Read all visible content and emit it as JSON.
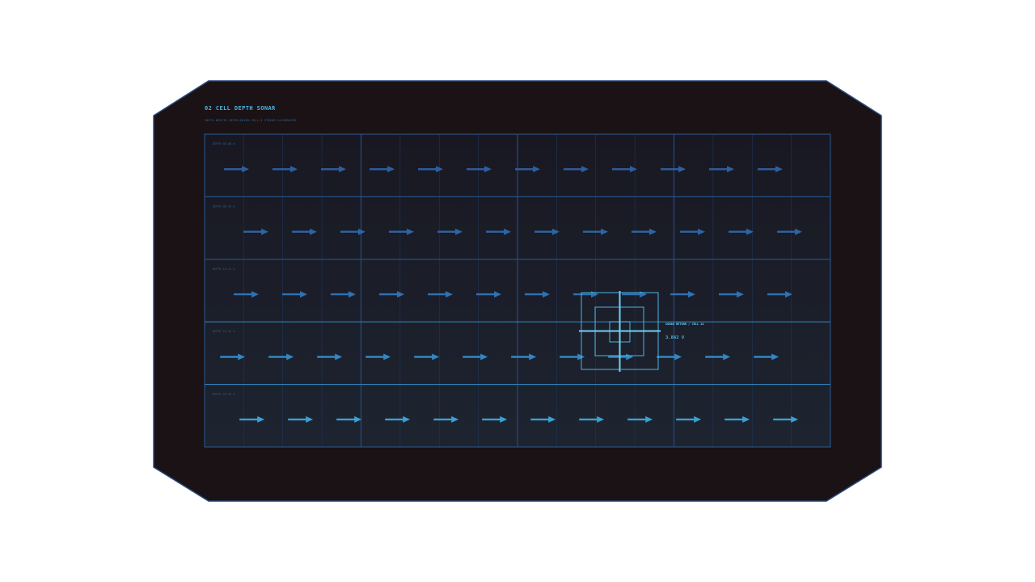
{
  "panel": {
    "title": "02  CELL DEPTH SONAR",
    "subtitle": "INCTU-BEDITH-INTERLEAVED-CELL-5 STREAM CALIBRATOR"
  },
  "layers": [
    {
      "label": "DEPTH 00-08 m",
      "arrow_color": "#2c5f9e",
      "count": 12,
      "offset": 0
    },
    {
      "label": "DEPTH 08-16 m",
      "arrow_color": "#2c64a6",
      "count": 12,
      "offset": 1
    },
    {
      "label": "DEPTH 16-24 m",
      "arrow_color": "#2d72b4",
      "count": 12,
      "offset": 0.5
    },
    {
      "label": "DEPTH 24-32 m",
      "arrow_color": "#3187c2",
      "count": 12,
      "offset": -0.2
    },
    {
      "label": "DEPTH 32-40 m",
      "arrow_color": "#3aa0d2",
      "count": 12,
      "offset": 0.8
    }
  ],
  "readout": {
    "title": "SONAR RETURN / CELL 14",
    "value": "3.842 V"
  },
  "colors": {
    "frame_bg": "#1a1214",
    "frame_border": "#2b4e86",
    "grid_line": "#244b80",
    "accent": "#4bb4e6",
    "reticle": "#5cc6ef"
  }
}
